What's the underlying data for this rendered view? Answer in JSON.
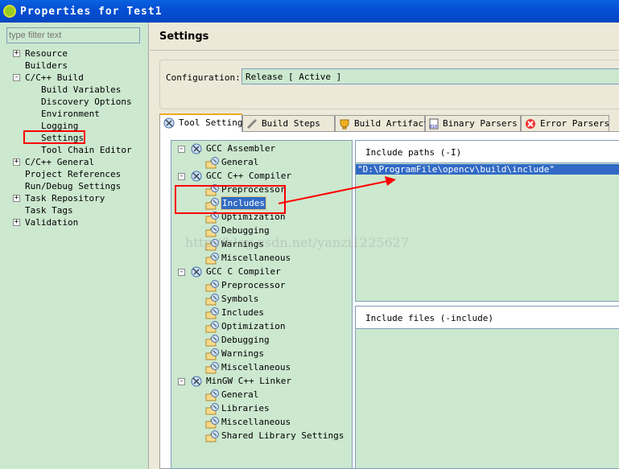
{
  "window": {
    "title": "Properties for Test1"
  },
  "filter": {
    "placeholder": "type filter text"
  },
  "nav": [
    {
      "label": "Resource",
      "depth": 0,
      "exp": "+"
    },
    {
      "label": "Builders",
      "depth": 0
    },
    {
      "label": "C/C++ Build",
      "depth": 0,
      "exp": "-"
    },
    {
      "label": "Build Variables",
      "depth": 1
    },
    {
      "label": "Discovery Options",
      "depth": 1
    },
    {
      "label": "Environment",
      "depth": 1
    },
    {
      "label": "Logging",
      "depth": 1
    },
    {
      "label": "Settings",
      "depth": 1,
      "highlighted": true
    },
    {
      "label": "Tool Chain Editor",
      "depth": 1
    },
    {
      "label": "C/C++ General",
      "depth": 0,
      "exp": "+"
    },
    {
      "label": "Project References",
      "depth": 0
    },
    {
      "label": "Run/Debug Settings",
      "depth": 0
    },
    {
      "label": "Task Repository",
      "depth": 0,
      "exp": "+"
    },
    {
      "label": "Task Tags",
      "depth": 0
    },
    {
      "label": "Validation",
      "depth": 0,
      "exp": "+"
    }
  ],
  "page": {
    "title": "Settings",
    "config_label": "Configuration:",
    "config_value": "Release  [ Active ]"
  },
  "tabs": [
    {
      "label": "Tool Settings",
      "icon": "tool-settings-icon",
      "active": true
    },
    {
      "label": "Build Steps",
      "icon": "build-steps-icon"
    },
    {
      "label": "Build Artifact",
      "icon": "build-artifact-icon"
    },
    {
      "label": "Binary Parsers",
      "icon": "binary-parsers-icon"
    },
    {
      "label": "Error Parsers",
      "icon": "error-parsers-icon"
    }
  ],
  "tool_tree": [
    {
      "label": "GCC Assembler",
      "depth": 0,
      "exp": "-",
      "icon": "tool"
    },
    {
      "label": "General",
      "depth": 1,
      "icon": "folder"
    },
    {
      "label": "GCC C++ Compiler",
      "depth": 0,
      "exp": "-",
      "icon": "tool"
    },
    {
      "label": "Preprocessor",
      "depth": 1,
      "icon": "folder"
    },
    {
      "label": "Includes",
      "depth": 1,
      "icon": "folder",
      "selected": true
    },
    {
      "label": "Optimization",
      "depth": 1,
      "icon": "folder"
    },
    {
      "label": "Debugging",
      "depth": 1,
      "icon": "folder"
    },
    {
      "label": "Warnings",
      "depth": 1,
      "icon": "folder"
    },
    {
      "label": "Miscellaneous",
      "depth": 1,
      "icon": "folder"
    },
    {
      "label": "GCC C Compiler",
      "depth": 0,
      "exp": "-",
      "icon": "tool"
    },
    {
      "label": "Preprocessor",
      "depth": 1,
      "icon": "folder"
    },
    {
      "label": "Symbols",
      "depth": 1,
      "icon": "folder"
    },
    {
      "label": "Includes",
      "depth": 1,
      "icon": "folder"
    },
    {
      "label": "Optimization",
      "depth": 1,
      "icon": "folder"
    },
    {
      "label": "Debugging",
      "depth": 1,
      "icon": "folder"
    },
    {
      "label": "Warnings",
      "depth": 1,
      "icon": "folder"
    },
    {
      "label": "Miscellaneous",
      "depth": 1,
      "icon": "folder"
    },
    {
      "label": "MinGW C++ Linker",
      "depth": 0,
      "exp": "-",
      "icon": "tool"
    },
    {
      "label": "General",
      "depth": 1,
      "icon": "folder"
    },
    {
      "label": "Libraries",
      "depth": 1,
      "icon": "folder"
    },
    {
      "label": "Miscellaneous",
      "depth": 1,
      "icon": "folder"
    },
    {
      "label": "Shared Library Settings",
      "depth": 1,
      "icon": "folder"
    }
  ],
  "include_paths": {
    "title": "Include paths (-I)",
    "items": [
      "\"D:\\ProgramFile\\opencv\\build\\include\""
    ]
  },
  "include_files": {
    "title": "Include files (-include)",
    "items": []
  },
  "watermark": "http://blog.csdn.net/yanzi1225627",
  "colors": {
    "panel": "#CCE8CF",
    "selection": "#316AC5",
    "annotation": "#FF0000",
    "titlebar": "#0550D4"
  }
}
